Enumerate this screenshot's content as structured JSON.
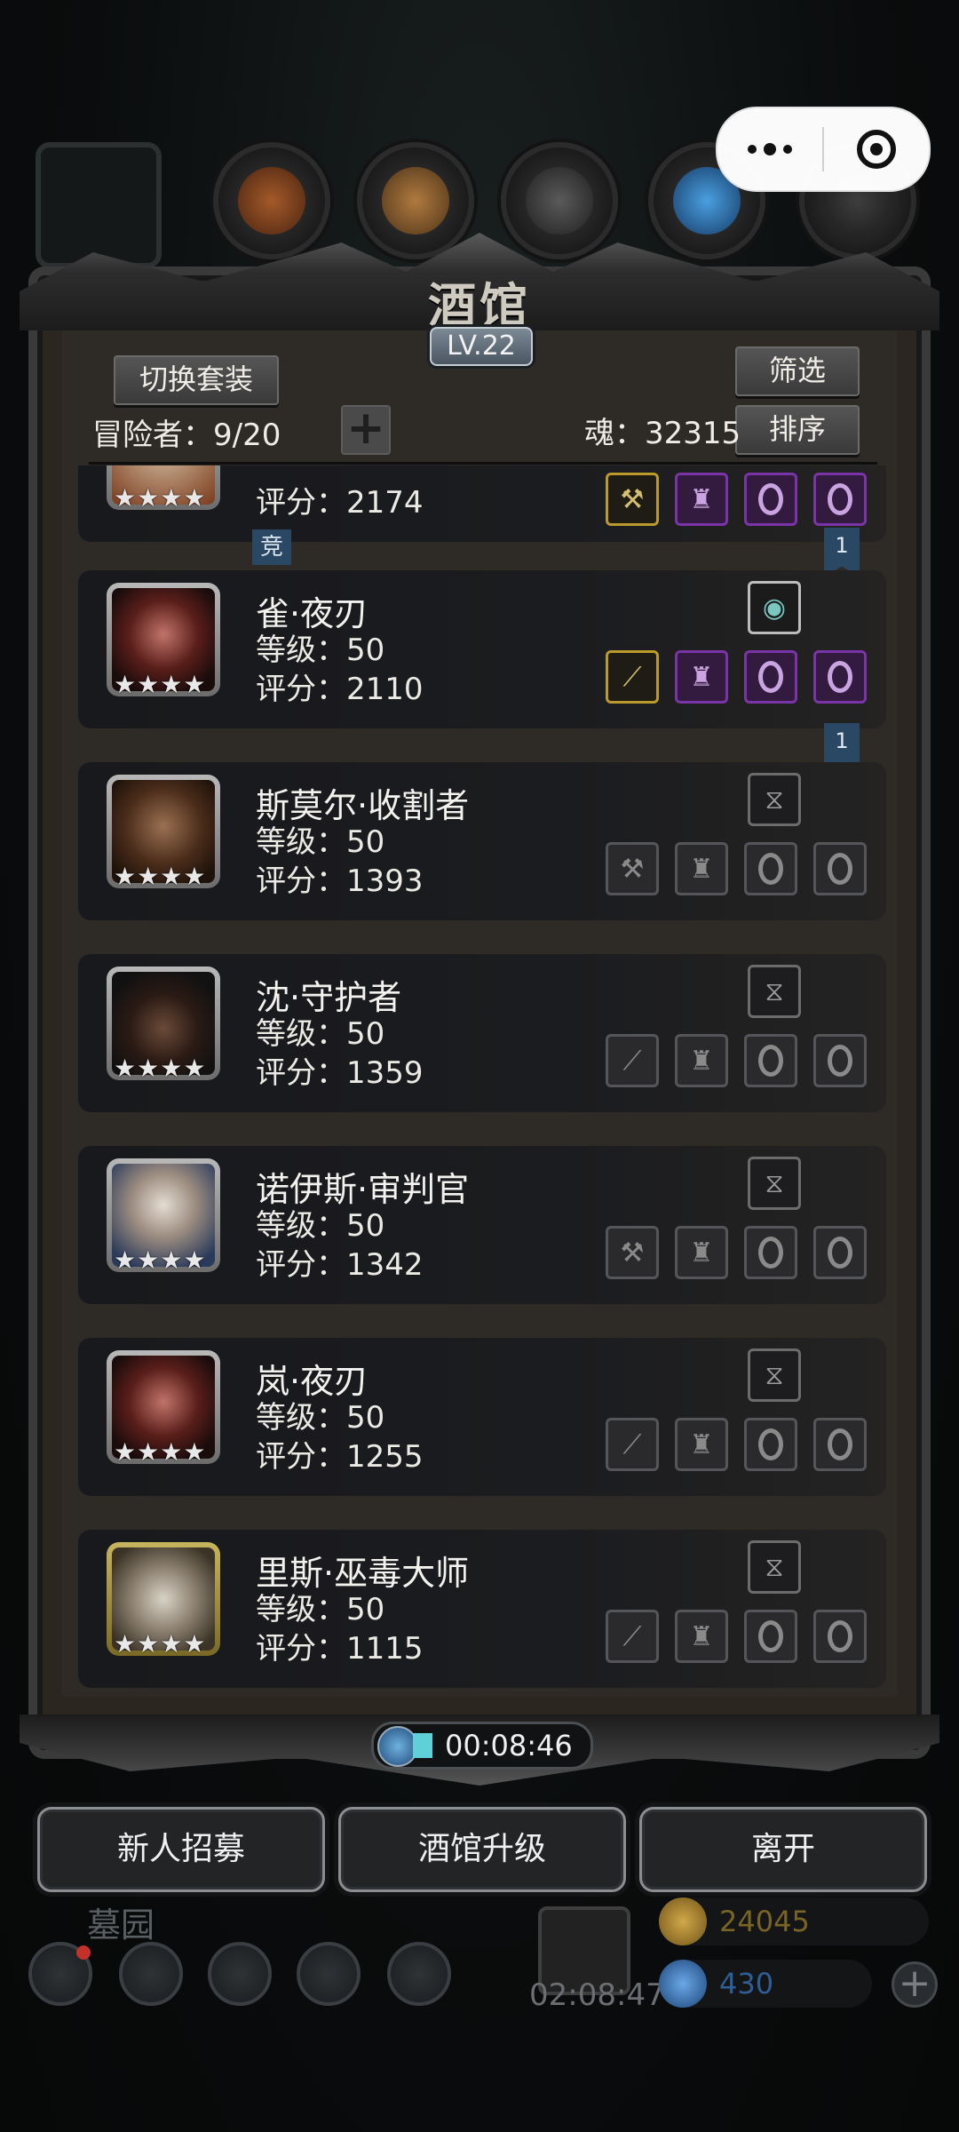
{
  "window": {
    "title": "酒馆",
    "level": "LV.22"
  },
  "mini_program": {
    "more_icon": "more-dots-icon",
    "close_icon": "target-close-icon"
  },
  "header": {
    "switch_set_label": "切换套装",
    "filter_label": "筛选",
    "sort_label": "排序",
    "adventurers_label": "冒险者：9/20",
    "soul_label": "魂：32315",
    "add_icon": "plus-icon"
  },
  "heroes": [
    {
      "name": "",
      "level": "",
      "score": "评分：2174",
      "stars": 4,
      "partial": true
    },
    {
      "name": "雀·夜刃",
      "level": "等级：50",
      "score": "评分：2110",
      "stars": 4,
      "flag": "1"
    },
    {
      "name": "斯莫尔·收割者",
      "level": "等级：50",
      "score": "评分：1393",
      "stars": 4
    },
    {
      "name": "沈·守护者",
      "level": "等级：50",
      "score": "评分：1359",
      "stars": 4
    },
    {
      "name": "诺伊斯·审判官",
      "level": "等级：50",
      "score": "评分：1342",
      "stars": 4
    },
    {
      "name": "岚·夜刃",
      "level": "等级：50",
      "score": "评分：1255",
      "stars": 4
    },
    {
      "name": "里斯·巫毒大师",
      "level": "等级：50",
      "score": "评分：1115",
      "stars": 4
    }
  ],
  "badges": {
    "first_flag": "1",
    "compete_tag": "竞"
  },
  "timer": {
    "value": "00:08:46"
  },
  "actions": {
    "recruit": "新人招募",
    "upgrade": "酒馆升级",
    "leave": "离开"
  },
  "footer": {
    "location": "墓园",
    "gift_timer": "02:08:47",
    "gold": "24045",
    "gems": "430",
    "gold_color": "#b08a2e",
    "gem_color": "#3b7cc4"
  }
}
